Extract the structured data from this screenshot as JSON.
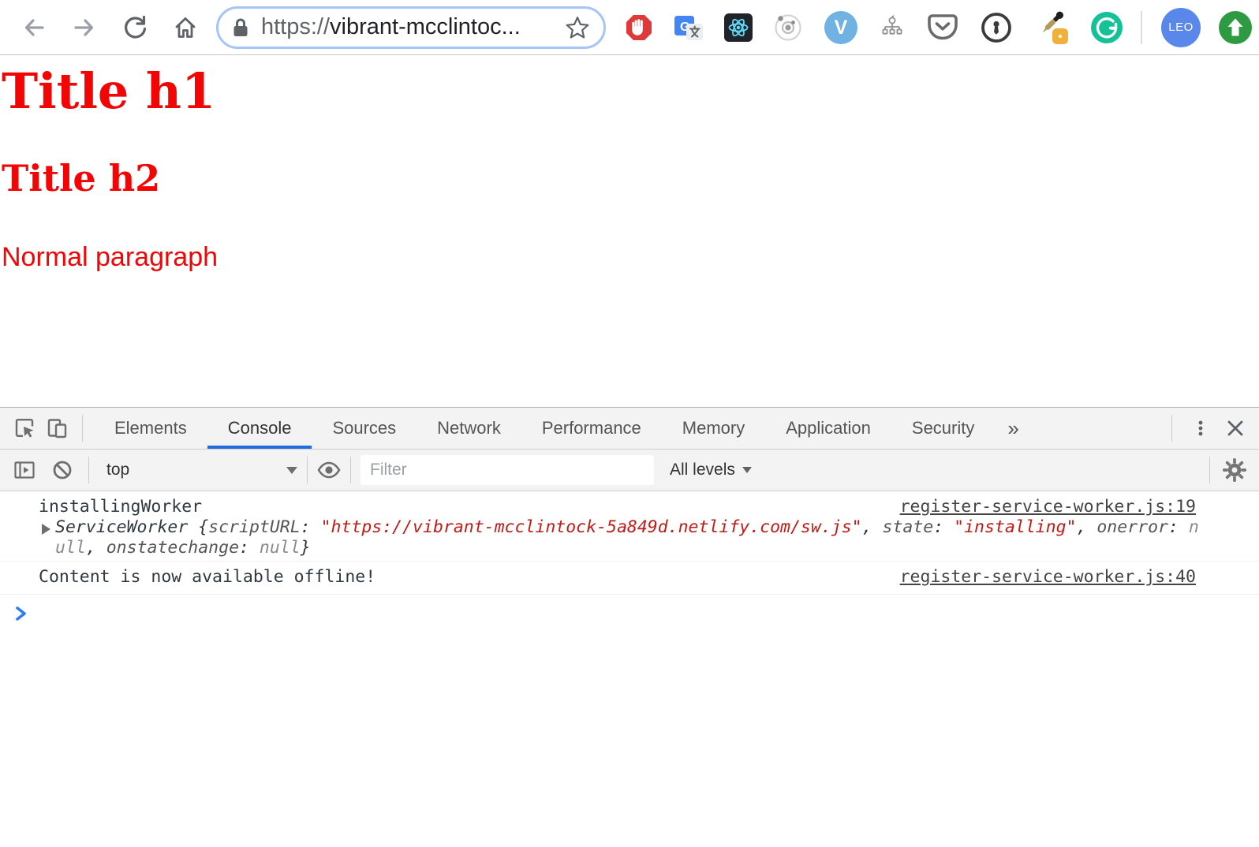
{
  "browser": {
    "url_bar": {
      "scheme": "https://",
      "host": "vibrant-mcclintoc..."
    },
    "extensions": [
      {
        "name": "adblock"
      },
      {
        "name": "google-translate"
      },
      {
        "name": "react-devtools"
      },
      {
        "name": "orbit"
      },
      {
        "name": "vimium"
      },
      {
        "name": "tree-diagram"
      },
      {
        "name": "pocket"
      },
      {
        "name": "onepassword"
      },
      {
        "name": "color-picker"
      },
      {
        "name": "grammarly"
      }
    ],
    "profile": {
      "label": "LEO"
    }
  },
  "page": {
    "heading1": "Title h1",
    "heading2": "Title h2",
    "paragraph": "Normal paragraph",
    "text_color": "#ff0000"
  },
  "devtools": {
    "tabs": [
      "Elements",
      "Console",
      "Sources",
      "Network",
      "Performance",
      "Memory",
      "Application",
      "Security"
    ],
    "active_tab": "Console",
    "more_tabs_label": "»",
    "console_toolbar": {
      "context": "top",
      "filter_placeholder": "Filter",
      "levels": "All levels"
    },
    "console": {
      "messages": [
        {
          "line": "installingWorker",
          "source": "register-service-worker.js:19",
          "preview_segments": [
            {
              "t": "ServiceWorker ",
              "s": "cls"
            },
            {
              "t": "{",
              "s": "pln"
            },
            {
              "t": "scriptURL",
              "s": "key"
            },
            {
              "t": ": ",
              "s": "pln"
            },
            {
              "t": "\"https://vibrant-mcclintock-5a849d.netlify.com/sw.js\"",
              "s": "str"
            },
            {
              "t": ", ",
              "s": "pln"
            },
            {
              "t": "state",
              "s": "key"
            },
            {
              "t": ": ",
              "s": "pln"
            },
            {
              "t": "\"installing\"",
              "s": "str"
            },
            {
              "t": ", ",
              "s": "pln"
            },
            {
              "t": "onerror",
              "s": "key"
            },
            {
              "t": ": ",
              "s": "pln"
            },
            {
              "t": "n",
              "s": "nul"
            },
            {
              "br": true
            },
            {
              "t": "ull",
              "s": "nul"
            },
            {
              "t": ", ",
              "s": "pln"
            },
            {
              "t": "onstatechange",
              "s": "key"
            },
            {
              "t": ": ",
              "s": "pln"
            },
            {
              "t": "null",
              "s": "nul"
            },
            {
              "t": "}",
              "s": "pln"
            }
          ]
        },
        {
          "text": "Content is now available offline!",
          "source": "register-service-worker.js:40"
        }
      ]
    }
  },
  "colors": {
    "accent_blue": "#1f6fe0",
    "console_string_red": "#c41a16",
    "page_text_red": "#f40505",
    "url_focus_ring": "#a5c4f7"
  }
}
